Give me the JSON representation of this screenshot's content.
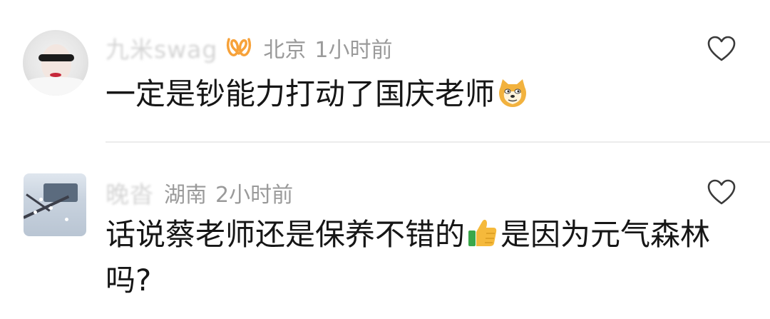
{
  "comments": [
    {
      "username": "九米swag",
      "location": "北京",
      "time": "1小时前",
      "text": "一定是钞能力打动了国庆老师",
      "emoji": "doge-emoji",
      "badge_color": "#f7a23a"
    },
    {
      "username": "晚沓",
      "location": "湖南",
      "time": "2小时前",
      "text_part1": "话说蔡老师还是保养不错的",
      "text_part2": "是因为元气森林吗?",
      "emoji": "thumbs-up-emoji"
    }
  ],
  "icons": {
    "like": "heart-outline-icon"
  }
}
